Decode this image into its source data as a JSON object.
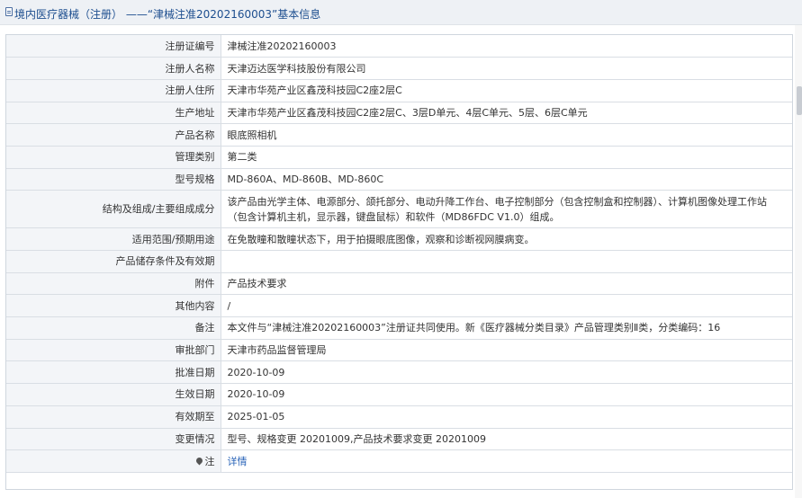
{
  "header": {
    "title": "境内医疗器械（注册） ——“津械注准20202160003”基本信息"
  },
  "rows": [
    {
      "label": "注册证编号",
      "value": "津械注准20202160003"
    },
    {
      "label": "注册人名称",
      "value": "天津迈达医学科技股份有限公司"
    },
    {
      "label": "注册人住所",
      "value": "天津市华苑产业区鑫茂科技园C2座2层C"
    },
    {
      "label": "生产地址",
      "value": "天津市华苑产业区鑫茂科技园C2座2层C、3层D单元、4层C单元、5层、6层C单元"
    },
    {
      "label": "产品名称",
      "value": "眼底照相机"
    },
    {
      "label": "管理类别",
      "value": "第二类"
    },
    {
      "label": "型号规格",
      "value": "MD-860A、MD-860B、MD-860C"
    },
    {
      "label": "结构及组成/主要组成成分",
      "value": "该产品由光学主体、电源部分、颌托部分、电动升降工作台、电子控制部分（包含控制盒和控制器）、计算机图像处理工作站（包含计算机主机，显示器，键盘鼠标）和软件（MD86FDC V1.0）组成。"
    },
    {
      "label": "适用范围/预期用途",
      "value": "在免散瞳和散瞳状态下，用于拍摄眼底图像，观察和诊断视网膜病变。"
    },
    {
      "label": "产品储存条件及有效期",
      "value": ""
    },
    {
      "label": "附件",
      "value": "产品技术要求"
    },
    {
      "label": "其他内容",
      "value": "/"
    },
    {
      "label": "备注",
      "value": "本文件与“津械注准20202160003”注册证共同使用。新《医疗器械分类目录》产品管理类别Ⅱ类，分类编码：16"
    },
    {
      "label": "审批部门",
      "value": "天津市药品监督管理局"
    },
    {
      "label": "批准日期",
      "value": "2020-10-09"
    },
    {
      "label": "生效日期",
      "value": "2020-10-09"
    },
    {
      "label": "有效期至",
      "value": "2025-01-05"
    },
    {
      "label": "变更情况",
      "value": "型号、规格变更 20201009,产品技术要求变更 20201009"
    }
  ],
  "note_row": {
    "label": "注",
    "link": "详情",
    "icon": "pin-icon"
  }
}
